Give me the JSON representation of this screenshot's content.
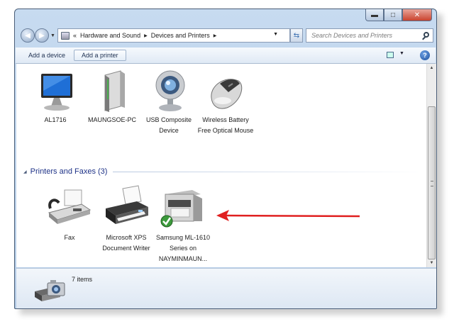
{
  "window": {
    "caption": {
      "minimize": "▬",
      "maximize": "□",
      "close": "✕"
    }
  },
  "address_bar": {
    "overflow": "«",
    "crumbs": [
      "Hardware and Sound",
      "Devices and Printers"
    ],
    "search_placeholder": "Search Devices and Printers"
  },
  "toolbar": {
    "add_device": "Add a device",
    "add_printer": "Add a printer",
    "help": "?"
  },
  "devices": [
    {
      "label": "AL1716",
      "icon": "monitor-icon"
    },
    {
      "label": "MAUNGSOE-PC",
      "icon": "computer-tower-icon"
    },
    {
      "label": "USB Composite Device",
      "icon": "webcam-icon"
    },
    {
      "label": "Wireless Battery Free Optical Mouse",
      "icon": "mouse-icon"
    }
  ],
  "printers_group": {
    "title": "Printers and Faxes (3)",
    "items": [
      {
        "label": "Fax",
        "icon": "fax-icon"
      },
      {
        "label": "Microsoft XPS Document Writer",
        "icon": "printer-icon"
      },
      {
        "label": "Samsung ML-1610 Series on NAYMINMAUN...",
        "icon": "printer-default-icon",
        "default": true
      }
    ]
  },
  "annotation": {
    "color": "#e02020"
  },
  "details": {
    "count": "7 items",
    "icon": "camera-printer-icon"
  }
}
